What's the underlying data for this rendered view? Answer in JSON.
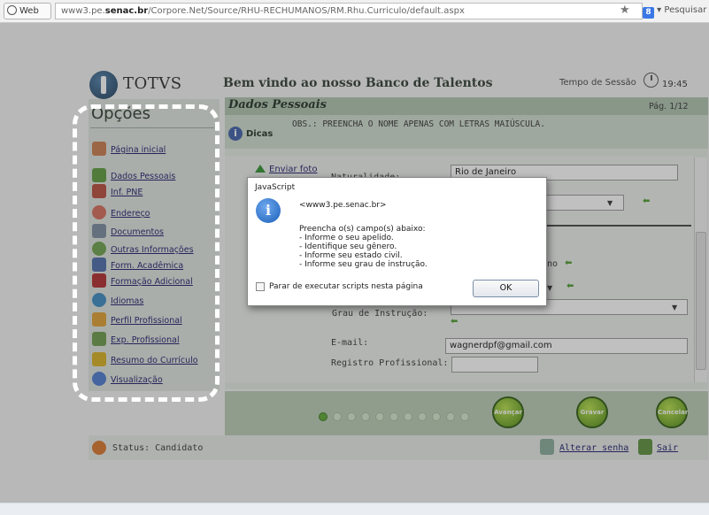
{
  "browser": {
    "web_label": "Web",
    "url_prefix": "www3.pe.",
    "url_domain": "senac.br",
    "url_path": "/Corpore.Net/Source/RHU-RECHUMANOS/RM.Rhu.Curriculo/default.aspx",
    "search_label": "Pesquisar"
  },
  "header": {
    "brand": "TOTVS",
    "welcome": "Bem vindo ao nosso Banco de Talentos",
    "session_label": "Tempo de Sessão",
    "session_time": "19:45"
  },
  "sidebar": {
    "title": "Opções",
    "items": [
      {
        "label": "Página inicial",
        "icon": "home-icon"
      },
      {
        "label": "Dados Pessoais",
        "icon": "people-icon"
      },
      {
        "label": "Inf. PNE",
        "icon": "wheelchair-icon"
      },
      {
        "label": "Endereço",
        "icon": "address-icon"
      },
      {
        "label": "Documentos",
        "icon": "documents-icon"
      },
      {
        "label": "Outras Informações",
        "icon": "question-icon"
      },
      {
        "label": "Form. Acadêmica",
        "icon": "academic-icon"
      },
      {
        "label": "Formação Adicional",
        "icon": "additional-icon"
      },
      {
        "label": "Idiomas",
        "icon": "globe-icon"
      },
      {
        "label": "Perfil Profissional",
        "icon": "profile-icon"
      },
      {
        "label": "Exp. Profissional",
        "icon": "experience-icon"
      },
      {
        "label": "Resumo do Currículo",
        "icon": "summary-icon"
      },
      {
        "label": "Visualização",
        "icon": "magnifier-icon"
      }
    ]
  },
  "main": {
    "section_title": "Dados Pessoais",
    "page_indicator": "Pág. 1/12",
    "obs": "OBS.: PREENCHA O NOME APENAS COM LETRAS MAIÚSCULA.",
    "dicas": "Dicas",
    "enviar_foto": "Enviar foto",
    "fields": {
      "naturalidade_label": "Naturalidade:",
      "naturalidade_value": "Rio de Janeiro",
      "grau_label": "Grau de Instrução:",
      "email_label": "E-mail:",
      "email_value": "wagnerdpf@gmail.com",
      "registro_label": "Registro Profissional:",
      "partial_no": "no"
    },
    "buttons": {
      "avancar": "Avançar",
      "gravar": "Gravar",
      "cancelar": "Cancelar"
    },
    "pager_dots": 11,
    "pager_active": 1
  },
  "status": {
    "text": "Status: Candidato",
    "alterar": "Alterar senha",
    "sair": "Sair"
  },
  "dialog": {
    "title": "JavaScript",
    "origin": "<www3.pe.senac.br>",
    "message_lines": [
      "Preencha o(s) campo(s) abaixo:",
      "- Informe o seu apelido.",
      "- Identifique seu gênero.",
      "- Informe seu estado civil.",
      "- Informe seu grau de instrução."
    ],
    "checkbox_label": "Parar de executar scripts nesta página",
    "ok_label": "OK"
  }
}
